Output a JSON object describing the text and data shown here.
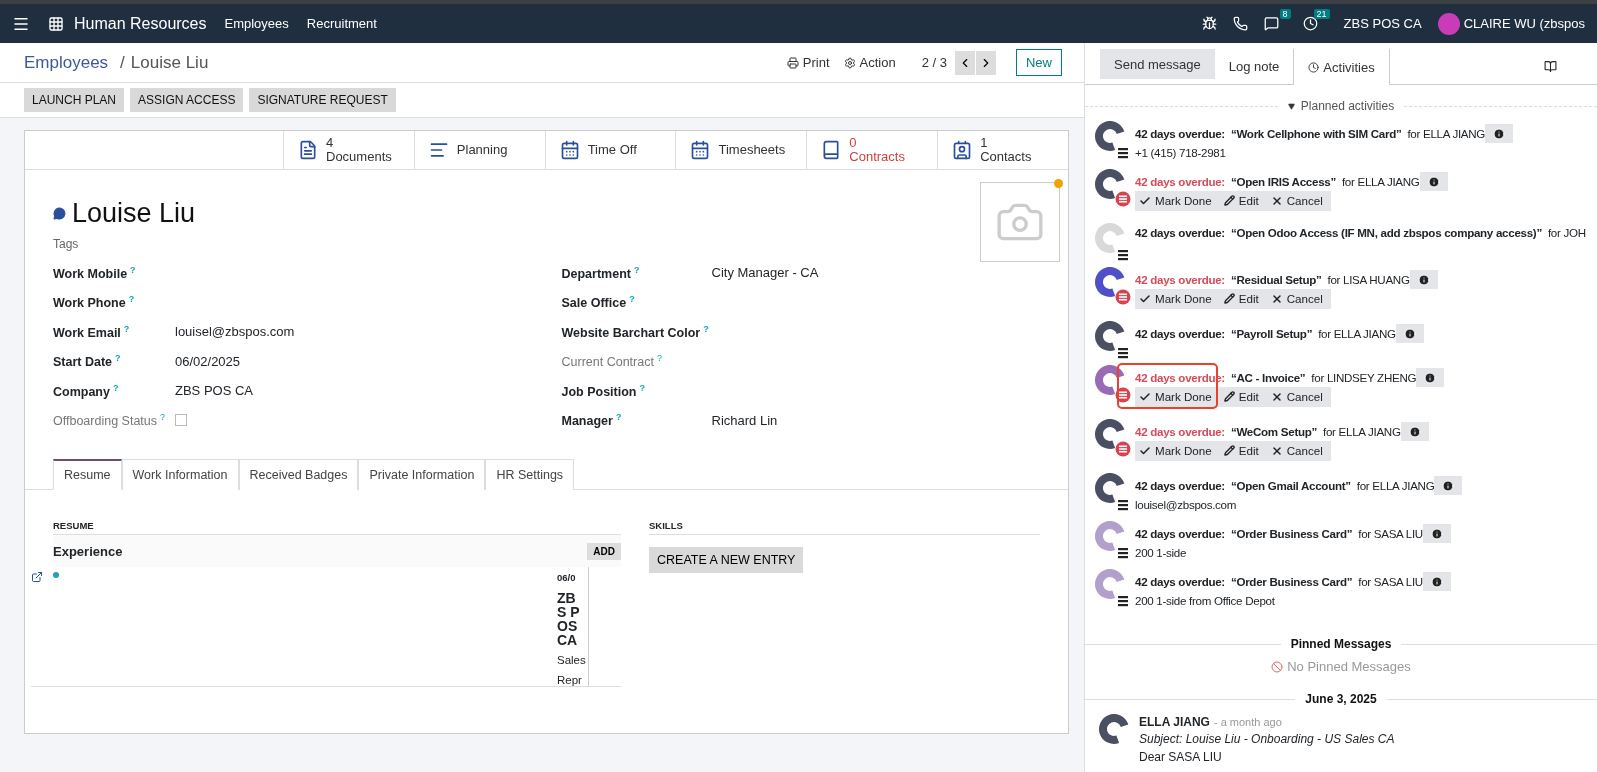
{
  "navbar": {
    "app_name": "Human Resources",
    "menu": [
      "Employees",
      "Recruitment"
    ],
    "chat_count": "8",
    "activity_count": "21",
    "company": "ZBS POS CA",
    "user": "CLAIRE WU (zbspos"
  },
  "control_panel": {
    "breadcrumb": "Employees",
    "separator": "/",
    "record": "Louise Liu",
    "print": "Print",
    "action": "Action",
    "pager": "2 / 3",
    "new": "New"
  },
  "action_buttons": [
    "LAUNCH PLAN",
    "ASSIGN ACCESS",
    "SIGNATURE REQUEST"
  ],
  "stat_buttons": [
    {
      "kind": "documents",
      "count": "4",
      "label": "Documents",
      "alert": false
    },
    {
      "kind": "planning",
      "label": "Planning",
      "alert": false
    },
    {
      "kind": "timeoff",
      "label": "Time Off",
      "alert": false
    },
    {
      "kind": "timesheets",
      "label": "Timesheets",
      "alert": false
    },
    {
      "kind": "contracts",
      "count": "0",
      "label": "Contracts",
      "alert": true
    },
    {
      "kind": "contacts",
      "count": "1",
      "label": "Contacts",
      "alert": false
    }
  ],
  "employee": {
    "name": "Louise Liu",
    "tags_placeholder": "Tags",
    "photo_pending": true
  },
  "fields_left": [
    {
      "kind": "text",
      "label": "Work Mobile",
      "help": "?",
      "muted": false
    },
    {
      "kind": "text",
      "label": "Work Phone",
      "help": "?",
      "muted": false
    },
    {
      "kind": "text",
      "label": "Work Email",
      "help": "?",
      "value": "louisel@zbspos.com",
      "muted": false
    },
    {
      "kind": "text",
      "label": "Start Date",
      "help": "?",
      "value": "06/02/2025",
      "muted": false
    },
    {
      "kind": "text",
      "label": "Company",
      "help": "?",
      "value": "ZBS POS CA",
      "muted": false
    },
    {
      "kind": "checkbox",
      "label": "Offboarding Status",
      "help": "?",
      "checked": false,
      "muted": true
    }
  ],
  "fields_right": [
    {
      "kind": "text",
      "label": "Department",
      "help": "?",
      "value": "City Manager - CA",
      "muted": false
    },
    {
      "kind": "text",
      "label": "Sale Office",
      "help": "?",
      "muted": false
    },
    {
      "kind": "text",
      "label": "Website Barchart Color",
      "help": "?",
      "muted": false
    },
    {
      "kind": "text",
      "label": "Current Contract",
      "help": "?",
      "muted": true
    },
    {
      "kind": "text",
      "label": "Job Position",
      "help": "?",
      "muted": false
    },
    {
      "kind": "text",
      "label": "Manager",
      "help": "?",
      "value": "Richard Lin",
      "muted": false
    }
  ],
  "tabs": [
    {
      "label": "Resume",
      "selected": true
    },
    {
      "label": "Work Information",
      "selected": false
    },
    {
      "label": "Received Badges",
      "selected": false
    },
    {
      "label": "Private Information",
      "selected": false
    },
    {
      "label": "HR Settings",
      "selected": false
    }
  ],
  "resume": {
    "heading": "RESUME",
    "group": "Experience",
    "add": "ADD",
    "entry": {
      "date": "06/0",
      "title": "ZBS POS CA",
      "subtitle": "Sales Repr"
    }
  },
  "skills": {
    "heading": "SKILLS",
    "create": "CREATE A NEW ENTRY"
  },
  "chatter": {
    "tabs": [
      {
        "label": "Send message",
        "selected": true
      },
      {
        "label": "Log note",
        "selected": false
      },
      {
        "label": "Activities",
        "selected": false
      }
    ],
    "planned_heading": "Planned activities",
    "activities": [
      {
        "color": "#4b4f63",
        "overdue": "42 days overdue:",
        "title": "“Work Cellphone with SIM Card”",
        "assignee": "for ELLA JIANG",
        "note": "+1 (415) 718-2981",
        "expanded": false,
        "highlighted": false
      },
      {
        "color": "#4b4f63",
        "overdue": "42 days overdue:",
        "title": "“Open IRIS Access”",
        "assignee": "for ELLA JIANG",
        "expanded": true,
        "actions": [
          "Mark Done",
          "Edit",
          "Cancel"
        ],
        "highlighted": false
      },
      {
        "color": "#d9d9d9",
        "overdue": "42 days overdue:",
        "title": "“Open Odoo Access (IF MN, add zbspos company access)”",
        "assignee": "for JOH",
        "expanded": false,
        "highlighted": false
      },
      {
        "color": "#4f4fc8",
        "overdue": "42 days overdue:",
        "title": "“Residual Setup”",
        "assignee": "for LISA HUANG",
        "expanded": true,
        "actions": [
          "Mark Done",
          "Edit",
          "Cancel"
        ],
        "highlighted": false
      },
      {
        "color": "#4b4f63",
        "overdue": "42 days overdue:",
        "title": "“Payroll Setup”",
        "assignee": "for ELLA JIANG",
        "expanded": false,
        "highlighted": false
      },
      {
        "color": "#9a6bb5",
        "overdue": "42 days overdue:",
        "title": "“AC - Invoice”",
        "assignee": "for LINDSEY ZHENG",
        "expanded": true,
        "actions": [
          "Mark Done",
          "Edit",
          "Cancel"
        ],
        "highlighted": true
      },
      {
        "color": "#4b4f63",
        "overdue": "42 days overdue:",
        "title": "“WeCom Setup”",
        "assignee": "for ELLA JIANG",
        "expanded": true,
        "actions": [
          "Mark Done",
          "Edit",
          "Cancel"
        ],
        "highlighted": false
      },
      {
        "color": "#4b4f63",
        "overdue": "42 days overdue:",
        "title": "“Open Gmail Account”",
        "assignee": "for ELLA JIANG",
        "note": "louisel@zbspos.com",
        "expanded": false,
        "highlighted": false
      },
      {
        "color": "#b39fcc",
        "overdue": "42 days overdue:",
        "title": "“Order Business Card”",
        "assignee": "for SASA LIU",
        "note": "200 1-side",
        "expanded": false,
        "highlighted": false
      },
      {
        "color": "#b39fcc",
        "overdue": "42 days overdue:",
        "title": "“Order Business Card”",
        "assignee": "for SASA LIU",
        "note": "200 1-side from Office Depot",
        "expanded": false,
        "highlighted": false
      }
    ],
    "pinned_heading": "Pinned Messages",
    "pinned_empty": "No Pinned Messages",
    "date_heading": "June 3, 2025",
    "message": {
      "color": "#4b4f63",
      "author": "ELLA JIANG",
      "time": "- a month ago",
      "subject": "Subject: Louise Liu - Onboarding - US Sales CA",
      "body": "Dear SASA LIU"
    }
  }
}
